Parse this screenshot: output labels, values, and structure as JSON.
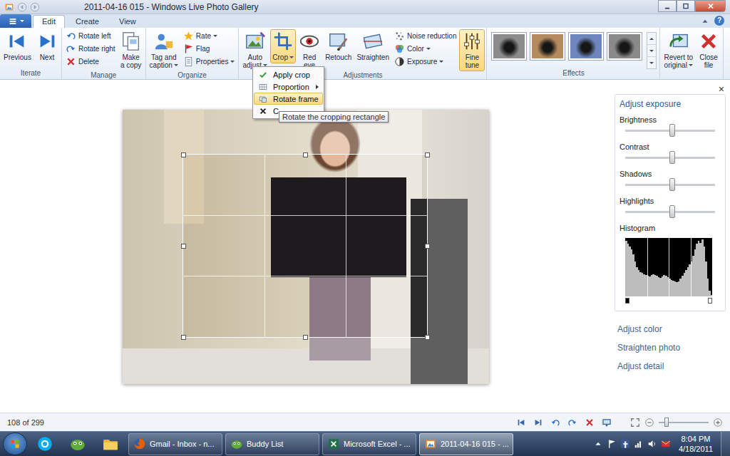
{
  "window": {
    "title": "2011-04-16 015 - Windows Live Photo Gallery"
  },
  "tabs": [
    {
      "label": "Edit",
      "selected": true
    },
    {
      "label": "Create",
      "selected": false
    },
    {
      "label": "View",
      "selected": false
    }
  ],
  "help": "?",
  "ribbon": {
    "groups": [
      {
        "label": "Iterate",
        "controls": [
          {
            "kind": "large",
            "lines": [
              "Previous"
            ],
            "dropdown": false,
            "selected": false
          },
          {
            "kind": "large",
            "lines": [
              "Next"
            ],
            "dropdown": false,
            "selected": false
          }
        ]
      },
      {
        "label": "Manage",
        "controls": [
          {
            "kind": "stack",
            "items": [
              {
                "label": "Rotate left",
                "dropdown": false
              },
              {
                "label": "Rotate right",
                "dropdown": false
              },
              {
                "label": "Delete",
                "dropdown": false
              }
            ]
          },
          {
            "kind": "large",
            "lines": [
              "Make",
              "a copy"
            ],
            "dropdown": false,
            "selected": false
          }
        ]
      },
      {
        "label": "Organize",
        "controls": [
          {
            "kind": "large",
            "lines": [
              "Tag and",
              "caption"
            ],
            "dropdown": true,
            "selected": false
          },
          {
            "kind": "stack",
            "items": [
              {
                "label": "Rate",
                "dropdown": true
              },
              {
                "label": "Flag",
                "dropdown": false
              },
              {
                "label": "Properties",
                "dropdown": true
              }
            ]
          }
        ]
      },
      {
        "label": "Adjustments",
        "controls": [
          {
            "kind": "large",
            "lines": [
              "Auto",
              "adjust"
            ],
            "dropdown": true,
            "selected": false
          },
          {
            "kind": "large",
            "lines": [
              "Crop"
            ],
            "dropdown": true,
            "selected": true
          },
          {
            "kind": "large",
            "lines": [
              "Red",
              "eye"
            ],
            "dropdown": false,
            "selected": false
          },
          {
            "kind": "large",
            "lines": [
              "Retouch"
            ],
            "dropdown": false,
            "selected": false
          },
          {
            "kind": "large",
            "lines": [
              "Straighten"
            ],
            "dropdown": false,
            "selected": false
          },
          {
            "kind": "stack",
            "items": [
              {
                "label": "Noise reduction",
                "dropdown": false
              },
              {
                "label": "Color",
                "dropdown": true
              },
              {
                "label": "Exposure",
                "dropdown": true
              }
            ]
          },
          {
            "kind": "large",
            "lines": [
              "Fine",
              "tune"
            ],
            "dropdown": false,
            "selected": true
          }
        ]
      },
      {
        "label": "Effects",
        "controls": [
          {
            "kind": "gallery",
            "thumbs": [
              {
                "color": "#8c8c8c"
              },
              {
                "color": "#b48a5e"
              },
              {
                "color": "#6d87bd"
              },
              {
                "color": "#8a8a8a"
              }
            ]
          }
        ]
      },
      {
        "controls": [
          {
            "kind": "large",
            "lines": [
              "Revert to",
              "original"
            ],
            "dropdown": true,
            "selected": false
          },
          {
            "kind": "large",
            "lines": [
              "Close",
              "file"
            ],
            "dropdown": false,
            "selected": false
          }
        ]
      }
    ]
  },
  "crop_menu": {
    "items": [
      {
        "label": "Apply crop",
        "kind": "check",
        "highlighted": false
      },
      {
        "label": "Proportion",
        "kind": "submenu",
        "highlighted": false
      },
      {
        "label": "Rotate frame",
        "kind": "rotate",
        "highlighted": true
      },
      {
        "label": "C",
        "kind": "cancel",
        "highlighted": false
      }
    ],
    "tooltip": "Rotate the cropping rectangle"
  },
  "adjust_panel": {
    "close": "×",
    "title": "Adjust exposure",
    "sliders": [
      {
        "label": "Brightness",
        "level": 0.52
      },
      {
        "label": "Contrast",
        "level": 0.52
      },
      {
        "label": "Shadows",
        "level": 0.52
      },
      {
        "label": "Highlights",
        "level": 0.52
      }
    ],
    "histogram": {
      "label": "Histogram",
      "black_point": 0,
      "white_point": 1,
      "values": [
        0.95,
        0.9,
        0.85,
        0.8,
        0.72,
        0.6,
        0.5,
        0.45,
        0.42,
        0.4,
        0.38,
        0.36,
        0.35,
        0.34,
        0.36,
        0.38,
        0.37,
        0.35,
        0.33,
        0.32,
        0.34,
        0.36,
        0.35,
        0.33,
        0.3,
        0.28,
        0.27,
        0.26,
        0.25,
        0.26,
        0.3,
        0.35,
        0.4,
        0.45,
        0.5,
        0.55,
        0.6,
        0.7,
        0.8,
        0.9,
        0.95,
        0.92,
        0.97,
        0.85,
        0.6,
        0.3,
        0.1,
        0.02
      ]
    },
    "links": [
      "Adjust color",
      "Straighten photo",
      "Adjust detail"
    ]
  },
  "status_bar": {
    "count": "108 of 299",
    "zoom": {
      "level": 0.15
    }
  },
  "taskbar": {
    "tasks": [
      {
        "label": "Gmail - Inbox - n...",
        "selected": false
      },
      {
        "label": "Buddy List",
        "selected": false
      },
      {
        "label": "Microsoft Excel - ...",
        "selected": false
      },
      {
        "label": "2011-04-16 015 - ...",
        "selected": true
      }
    ],
    "clock": {
      "time": "8:04 PM",
      "date": "4/18/2011"
    }
  }
}
